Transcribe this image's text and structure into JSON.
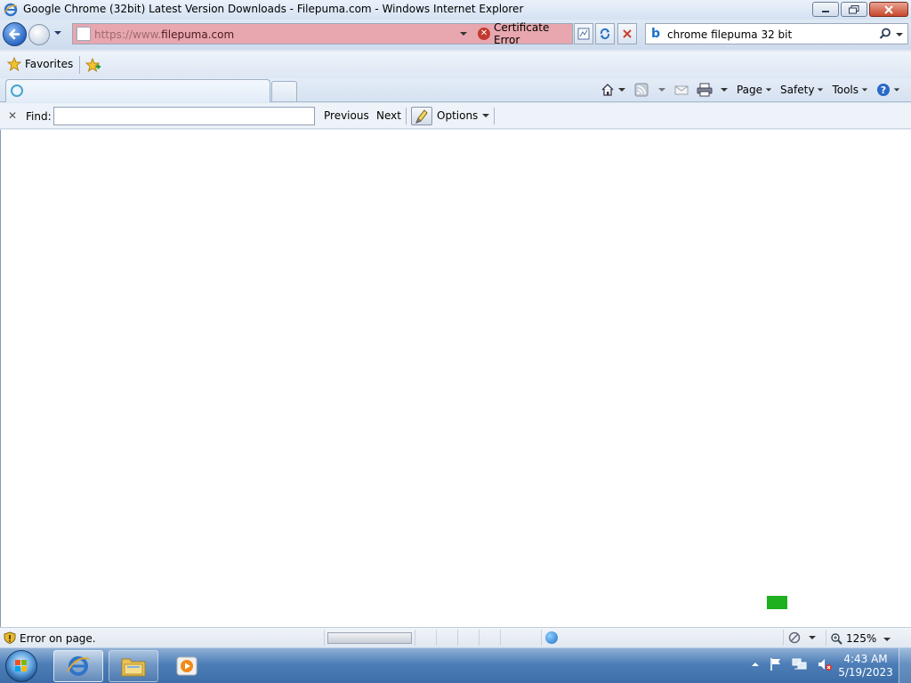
{
  "window": {
    "title": "Google Chrome (32bit) Latest Version Downloads - Filepuma.com - Windows Internet Explorer",
    "icon": "ie-icon"
  },
  "address": {
    "prefix": "https://www.",
    "host": "filepuma.com",
    "certificate_label": "Certificate Error",
    "background_color": "#e8a6ae"
  },
  "search": {
    "value": "chrome filepuma 32 bit",
    "provider_icon": "bing-icon"
  },
  "favorites": {
    "label": "Favorites"
  },
  "command_bar": {
    "page_label": "Page",
    "safety_label": "Safety",
    "tools_label": "Tools"
  },
  "find": {
    "label": "Find:",
    "value": "",
    "previous_label": "Previous",
    "next_label": "Next",
    "options_label": "Options"
  },
  "status": {
    "text": "Error on page.",
    "zoom": "125%",
    "progress": 0
  },
  "taskbar": {
    "time": "4:43 AM",
    "date": "5/19/2023"
  },
  "colors": {
    "content_marker": "#1eb01f",
    "cert_error": "#c23a2f"
  }
}
